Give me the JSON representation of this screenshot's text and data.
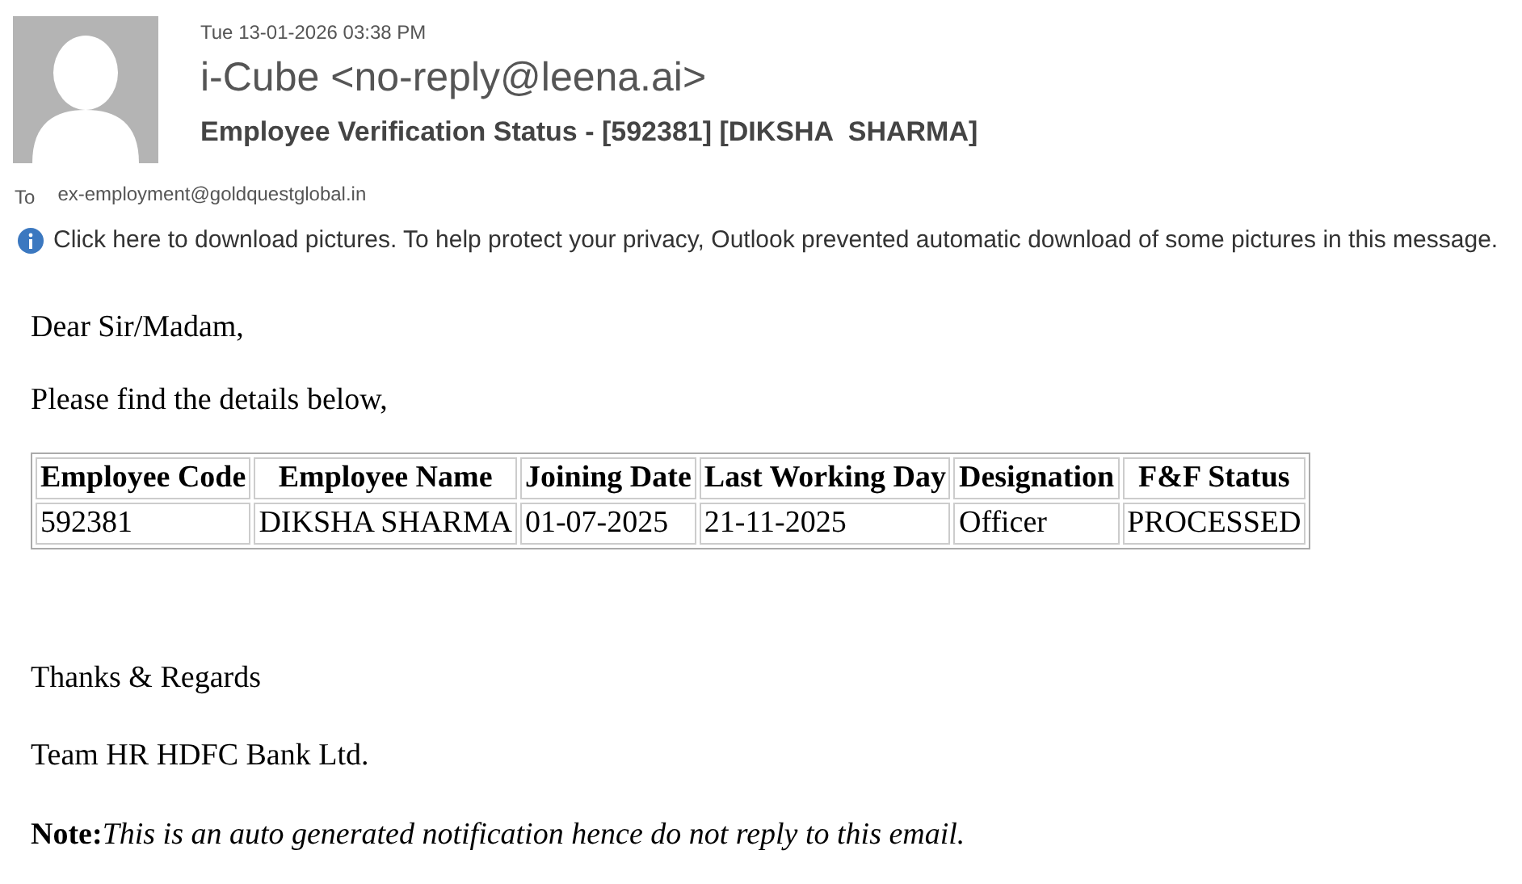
{
  "message": {
    "date": "Tue 13-01-2026 03:38 PM",
    "sender": "i-Cube <no-reply@leena.ai>",
    "subject": "Employee Verification Status - [592381] [DIKSHA  SHARMA]",
    "to_label": "To",
    "to": "ex-employment@goldquestglobal.in",
    "info_bar": "Click here to download pictures. To help protect your privacy, Outlook prevented automatic download of some pictures in this message."
  },
  "body": {
    "greeting": "Dear Sir/Madam,",
    "intro": "Please find the details below,",
    "table": {
      "columns": [
        "Employee Code",
        "Employee Name",
        "Joining Date",
        "Last Working Day",
        "Designation",
        "F&F Status"
      ],
      "rows": [
        [
          "592381",
          "DIKSHA SHARMA",
          "01-07-2025",
          "21-11-2025",
          "Officer",
          "PROCESSED"
        ]
      ]
    },
    "closing": "Thanks & Regards",
    "signature": "Team HR HDFC Bank Ltd.",
    "note_label": "Note:",
    "note": "This is an auto generated notification hence do not reply to this email."
  }
}
